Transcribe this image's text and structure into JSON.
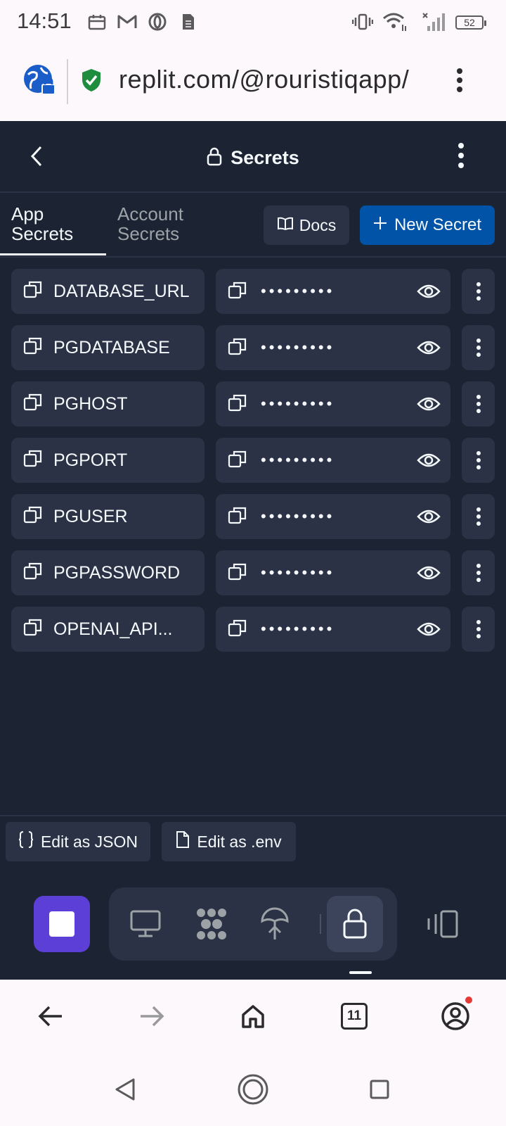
{
  "status_bar": {
    "time": "14:51",
    "battery": "52",
    "icons": [
      "calendar-icon",
      "gmail-icon",
      "opera-icon",
      "sim-icon",
      "vibrate-icon",
      "wifi-icon",
      "signal-icon",
      "battery-icon"
    ]
  },
  "browser": {
    "url": "replit.com/@rouristiqapp/",
    "tab_count": "11"
  },
  "header": {
    "title": "Secrets"
  },
  "tabs": {
    "app_line1": "App",
    "app_line2": "Secrets",
    "account_line1": "Account",
    "account_line2": "Secrets",
    "docs_label": "Docs",
    "new_secret_label": "New Secret"
  },
  "secrets": [
    {
      "key": "DATABASE_URL",
      "value_mask": "•••••••••"
    },
    {
      "key": "PGDATABASE",
      "value_mask": "•••••••••"
    },
    {
      "key": "PGHOST",
      "value_mask": "•••••••••"
    },
    {
      "key": "PGPORT",
      "value_mask": "•••••••••"
    },
    {
      "key": "PGUSER",
      "value_mask": "•••••••••"
    },
    {
      "key": "PGPASSWORD",
      "value_mask": "•••••••••"
    },
    {
      "key": "OPENAI_API...",
      "value_mask": "•••••••••"
    }
  ],
  "edit_bar": {
    "json_label": "Edit as JSON",
    "env_label": "Edit as .env"
  },
  "colors": {
    "background": "#1c2333",
    "surface": "#2b3245",
    "accent": "#0053a6",
    "stop_button": "#5c3fd6",
    "text": "#f5f9fc"
  }
}
